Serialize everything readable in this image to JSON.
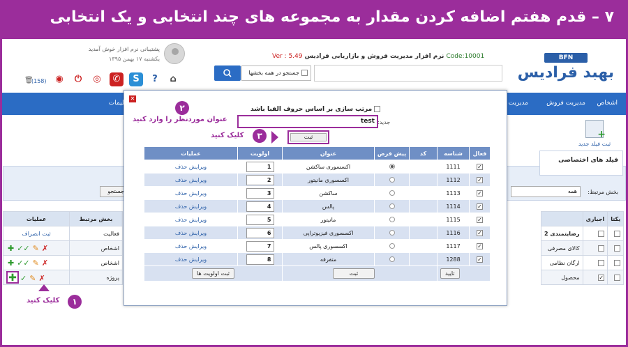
{
  "banner": {
    "title": "۷ – قدم هفتم اضافه کردن مقدار به مجموعه های چند انتخابی و یک انتخابی"
  },
  "header": {
    "welcome": "پشتیبانی نرم افزار خوش آمدید",
    "date": "یکشنبه ۱۷ بهمن ۱۳۹۵",
    "app_title": "نرم افزار مدیریت فروش و بازاریابی فرادیس",
    "code": "Code:10001",
    "version": "Ver : 5.49",
    "logo_badge": "BFN",
    "logo_text": "بهبد فرادیس",
    "notifications": "(158)",
    "search_all_label": "جستجو در همه بخشها"
  },
  "nav": {
    "items": [
      "اشخاص",
      "مدیریت فروش",
      "مدیریت",
      "ظیمات"
    ]
  },
  "page": {
    "add_field_label": "ثبت فیلد جدید",
    "custom_fields_title": "فیلد های اختصاصی",
    "filter_label": "بخش مرتبط:",
    "filter_value": "همه",
    "search_btn": "جستجو",
    "right_table": {
      "headers": [
        "یکتا",
        "اجباری",
        ""
      ],
      "rows": [
        {
          "name": "رضایتمندی 2"
        },
        {
          "name": "کالای مصرفی"
        },
        {
          "name": "ارگان نظامی"
        },
        {
          "name": "محصول"
        }
      ]
    },
    "left_table": {
      "headers": [
        "عملیات",
        "بخش مرتبط"
      ],
      "rows": [
        {
          "section": "فعالیت",
          "action": "ثبت انصراف"
        },
        {
          "section": "اشخاص"
        },
        {
          "section": "اشخاص"
        },
        {
          "section": "پروژه"
        }
      ]
    }
  },
  "modal": {
    "sort_label": "مرتب سازی بر اساس حروف الفبا باشد",
    "new_label": "جدید:",
    "new_value": "test",
    "save_label": "ثبت",
    "columns": [
      "فعال",
      "شناسه",
      "کد",
      "پیش فرض",
      "عنوان",
      "اولویت",
      "عملیات"
    ],
    "rows": [
      {
        "id": "1111",
        "title": "اکسسوری ساکشن",
        "priority": "1",
        "default": true
      },
      {
        "id": "1112",
        "title": "اکسسوری مانیتور",
        "priority": "2",
        "default": false
      },
      {
        "id": "1113",
        "title": "ساکشن",
        "priority": "3",
        "default": false
      },
      {
        "id": "1114",
        "title": "پالس",
        "priority": "4",
        "default": false
      },
      {
        "id": "1115",
        "title": "مانیتور",
        "priority": "5",
        "default": false
      },
      {
        "id": "1116",
        "title": "اکسسوری فیزیوتراپی",
        "priority": "6",
        "default": false
      },
      {
        "id": "1117",
        "title": "اکسسوری پالس",
        "priority": "7",
        "default": false
      },
      {
        "id": "1288",
        "title": "متفرقه",
        "priority": "8",
        "default": false
      }
    ],
    "edit_label": "ویرایش",
    "delete_label": "حذف",
    "confirm_btn": "تایید",
    "save_btn": "ثبت",
    "save_priority_btn": "ثبت اولویت ها"
  },
  "steps": {
    "step1": {
      "num": "۱",
      "text": "کلیک کنید"
    },
    "step2": {
      "num": "۲",
      "text": "عنوان موردنظر را وارد کنید"
    },
    "step3": {
      "num": "۳",
      "text": "کلیک کنید"
    }
  },
  "colors": {
    "accent": "#9b2d9b",
    "brand": "#2b6cc4",
    "header_blue": "#6f8fc5"
  }
}
